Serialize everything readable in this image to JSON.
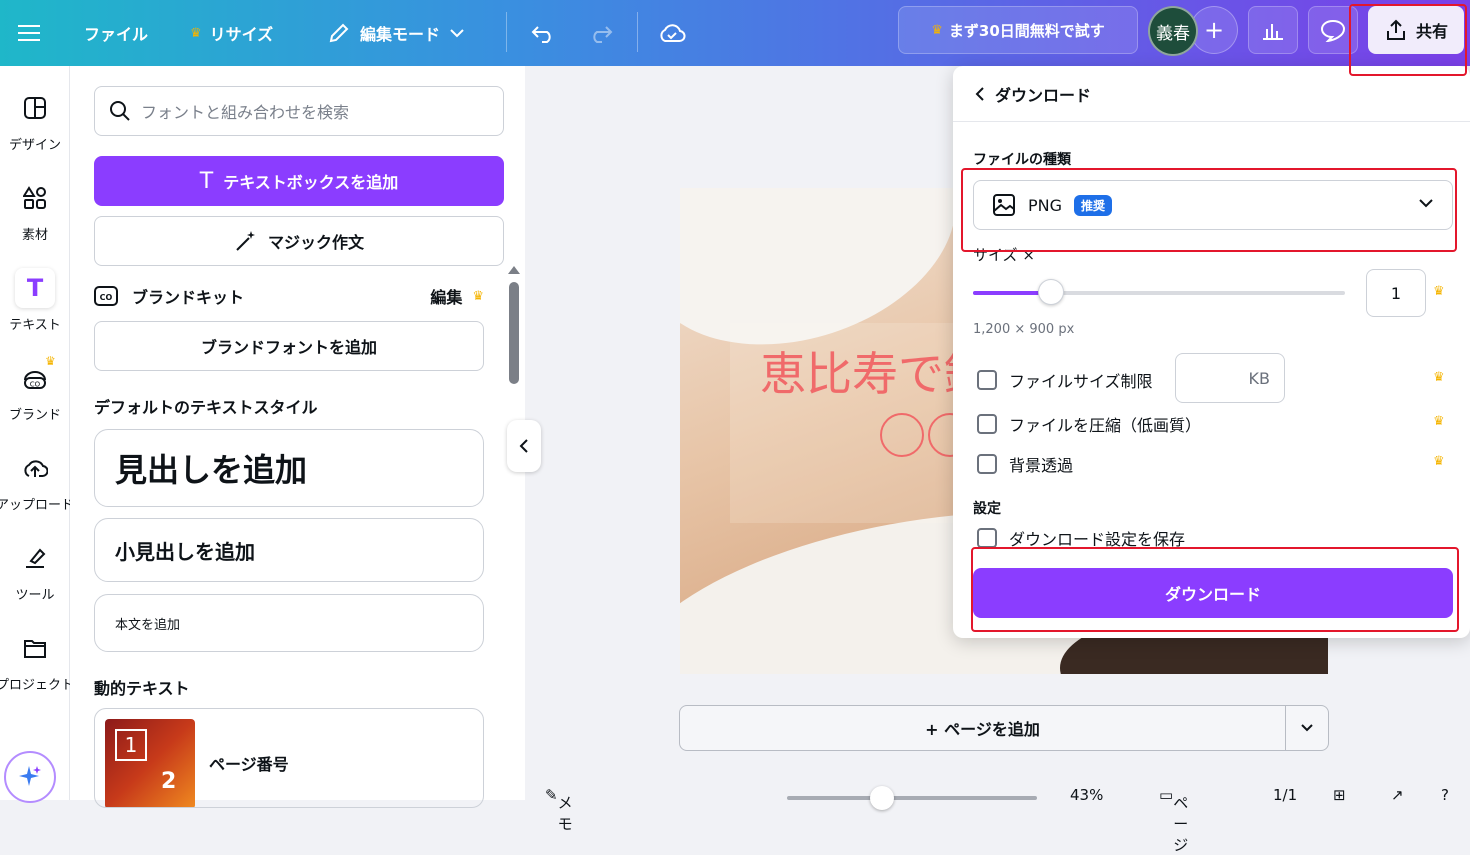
{
  "topbar": {
    "file": "ファイル",
    "resize": "リサイズ",
    "edit_mode": "編集モード",
    "trial": "まず30日間無料で試す",
    "avatar": "義春",
    "share": "共有"
  },
  "rail": {
    "design": "デザイン",
    "elements": "素材",
    "text": "テキスト",
    "brand": "ブランド",
    "uploads": "アップロード",
    "tools": "ツール",
    "projects": "プロジェクト"
  },
  "panel": {
    "search_placeholder": "フォントと組み合わせを検索",
    "add_textbox": "テキストボックスを追加",
    "magic_write": "マジック作文",
    "brand_kit": "ブランドキット",
    "brand_edit": "編集",
    "add_brand_font": "ブランドフォントを追加",
    "default_styles_title": "デフォルトのテキストスタイル",
    "heading": "見出しを追加",
    "subheading": "小見出しを追加",
    "body": "本文を追加",
    "dynamic_title": "動的テキスト",
    "page_number": "ページ番号",
    "thumb_num1": "1",
    "thumb_num2": "2"
  },
  "canvas": {
    "title_text": "恵比寿で鍼",
    "add_page": "+ ページを追加"
  },
  "footer": {
    "notes": "メモ",
    "zoom": "43%",
    "pages": "ページ",
    "page_count": "1/1"
  },
  "download": {
    "back_title": "ダウンロード",
    "file_type_label": "ファイルの種類",
    "file_type": "PNG",
    "recommended": "推奨",
    "size_label": "サイズ ×",
    "size_value": "1",
    "size_fraction": 0.21,
    "dimensions": "1,200 × 900 px",
    "limit_label": "ファイルサイズ制限",
    "kb": "KB",
    "compress_label": "ファイルを圧縮（低画質）",
    "transparent_label": "背景透過",
    "settings_label": "設定",
    "save_settings": "ダウンロード設定を保存",
    "download_button": "ダウンロード"
  }
}
